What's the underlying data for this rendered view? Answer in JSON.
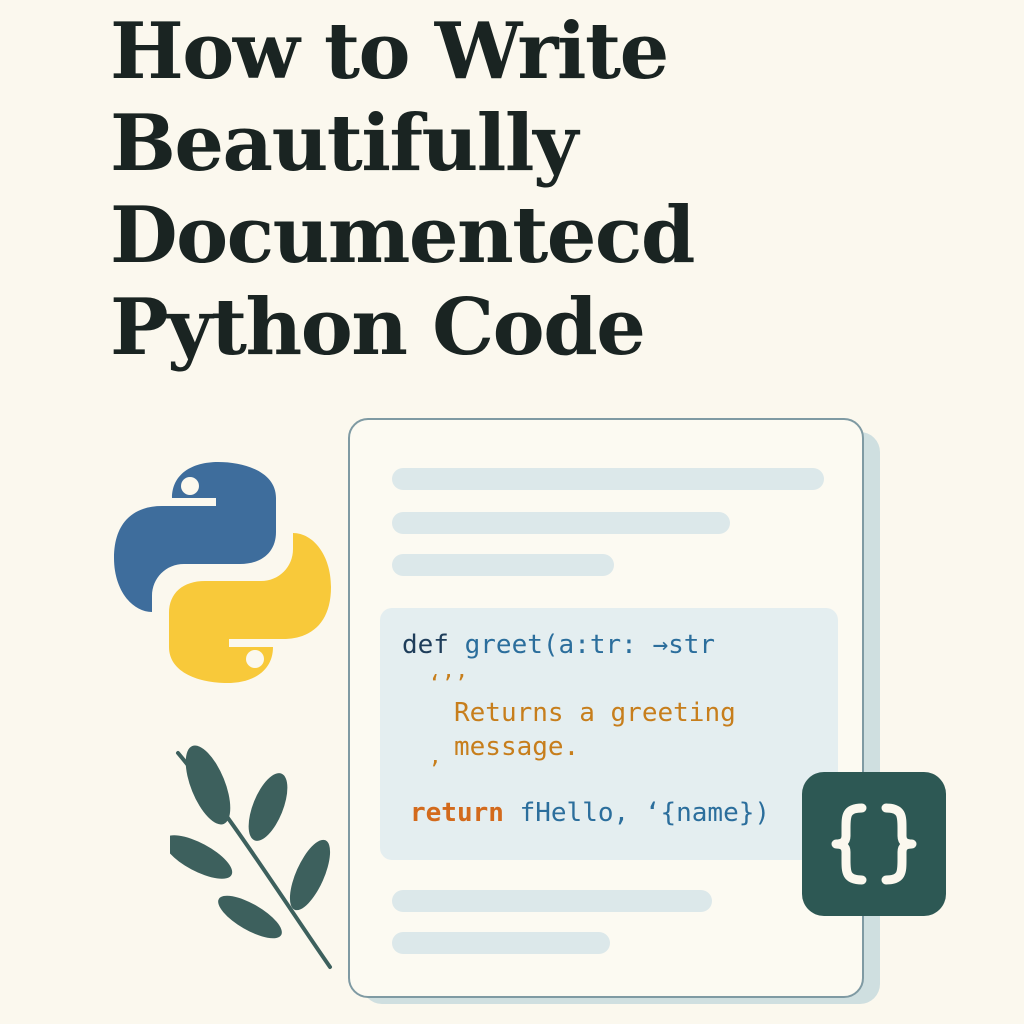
{
  "title": {
    "line1": "How to Write",
    "line2": "Beautifully",
    "line3": "Documentecd",
    "line4": "Python Code"
  },
  "code": {
    "line1": {
      "keyword": "def",
      "signature": "greet(a:tr: →str"
    },
    "docstring_open": "‘’’",
    "docstring_line1": "Returns a greeting",
    "docstring_line2": "message.",
    "docstring_close": "’",
    "return_line": {
      "keyword": "return",
      "value": "fHello, ‘{name})"
    }
  },
  "badge": {
    "text": "{}"
  },
  "icons": {
    "python": "python-logo-icon",
    "leaf": "leaf-branch-icon",
    "braces": "curly-braces-icon"
  },
  "colors": {
    "background": "#fbf8ee",
    "title": "#1a2422",
    "python_blue": "#3e6d9c",
    "python_yellow": "#f8c93a",
    "accent_teal": "#2d5854",
    "leaf": "#3d605d",
    "docstring": "#c77e1c",
    "keyword": "#1e3d5a"
  }
}
